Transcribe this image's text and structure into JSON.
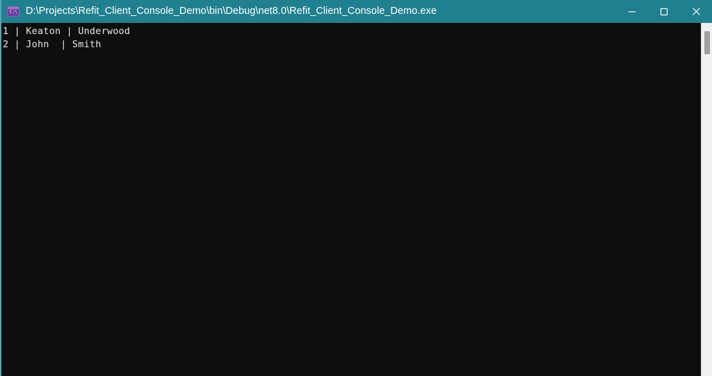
{
  "window": {
    "title": "D:\\Projects\\Refit_Client_Console_Demo\\bin\\Debug\\net8.0\\Refit_Client_Console_Demo.exe",
    "icon_name": "console-app-icon",
    "icon_glyph": "C:\\",
    "titlebar_color": "#21808f",
    "border_color": "#53a7b5",
    "console_background": "#0e0e0e",
    "console_foreground": "#e8e8e8"
  },
  "controls": {
    "minimize_label": "Minimize",
    "maximize_label": "Maximize",
    "close_label": "Close"
  },
  "console": {
    "output": "1 | Keaton | Underwood\n2 | John  | Smith",
    "lines": [
      "1 | Keaton | Underwood",
      "2 | John  | Smith"
    ],
    "rows": [
      {
        "id": "1",
        "first_name": "Keaton",
        "last_name": "Underwood"
      },
      {
        "id": "2",
        "first_name": "John",
        "last_name": "Smith"
      }
    ]
  },
  "scrollbar": {
    "name": "vertical-scrollbar",
    "thumb_color": "#a0a0a0",
    "track_color": "#f0f0f0"
  }
}
